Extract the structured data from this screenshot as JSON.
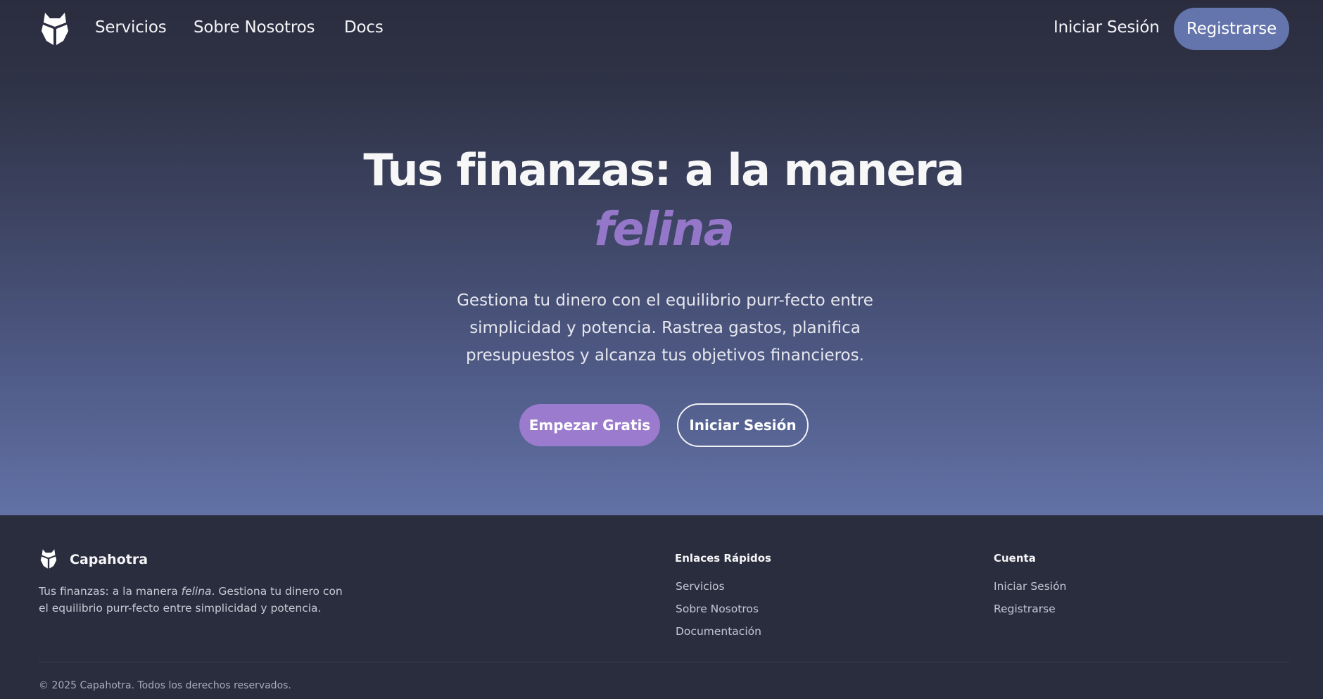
{
  "nav": {
    "services": "Servicios",
    "about": "Sobre Nosotros",
    "docs": "Docs",
    "login": "Iniciar Sesión",
    "register": "Registrarse"
  },
  "hero": {
    "title": "Tus finanzas: a la manera",
    "accent": "felina",
    "description": "Gestiona tu dinero con el equilibrio purr-fecto entre simplicidad y potencia. Rastrea gastos, planifica presupuestos y alcanza tus objetivos financieros.",
    "cta_primary": "Empezar Gratis",
    "cta_secondary": "Iniciar Sesión"
  },
  "footer": {
    "brand": "Capahotra",
    "desc_before": "Tus finanzas: a la manera ",
    "desc_italic": "felina",
    "desc_after": ". Gestiona tu dinero con el equilibrio purr-fecto entre simplicidad y potencia.",
    "quick_links": {
      "title": "Enlaces Rápidos",
      "items": [
        "Servicios",
        "Sobre Nosotros",
        "Documentación"
      ]
    },
    "account": {
      "title": "Cuenta",
      "items": [
        "Iniciar Sesión",
        "Registrarse"
      ]
    },
    "copyright": "© 2025 Capahotra. Todos los derechos reservados."
  },
  "icons": {
    "logo": "cat-logo-icon"
  },
  "colors": {
    "accent_purple": "#9577c9",
    "button_primary": "#9b7bcd",
    "button_register": "#6474ac",
    "background_dark": "#2a2d3d"
  }
}
